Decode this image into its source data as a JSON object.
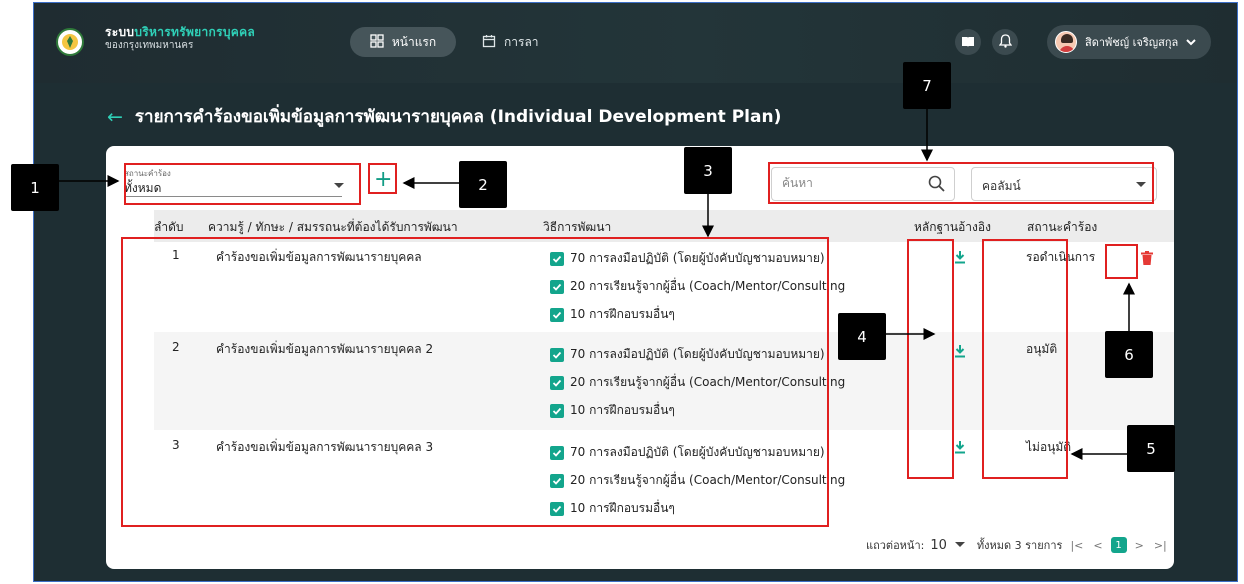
{
  "header": {
    "brand_line1_prefix": "ระบบ",
    "brand_line1_highlight": "บริหารทรัพยากรบุคคล",
    "brand_line2": "ของกรุงเทพมหานคร",
    "nav_home": "หน้าแรก",
    "nav_leave": "การลา",
    "user_name": "สิดาพัชญ์ เจริญสกุล",
    "icons": [
      "book-icon",
      "bell-icon",
      "chevron-down-icon"
    ]
  },
  "page": {
    "title": "รายการคำร้องขอเพิ่มข้อมูลการพัฒนารายบุคคล (Individual Development Plan)"
  },
  "filters": {
    "status_label": "สถานะคำร้อง",
    "status_value": "ทั้งหมด",
    "search_placeholder": "ค้นหา",
    "column_select": "คอลัมน์"
  },
  "table": {
    "headers": {
      "no": "ลำดับ",
      "topic": "ความรู้ / ทักษะ / สมรรถนะที่ต้องได้รับการพัฒนา",
      "method": "วิธีการพัฒนา",
      "evidence": "หลักฐานอ้างอิง",
      "status": "สถานะคำร้อง"
    },
    "rows": [
      {
        "no": "1",
        "topic": "คำร้องขอเพิ่มข้อมูลการพัฒนารายบุคคล",
        "methods": [
          "70 การลงมือปฏิบัติ (โดยผู้บังคับบัญชามอบหมาย)",
          "20 การเรียนรู้จากผู้อื่น (Coach/Mentor/Consulting",
          "10 การฝึกอบรมอื่นๆ"
        ],
        "status": "รอดำเนินการ"
      },
      {
        "no": "2",
        "topic": "คำร้องขอเพิ่มข้อมูลการพัฒนารายบุคคล 2",
        "methods": [
          "70 การลงมือปฏิบัติ (โดยผู้บังคับบัญชามอบหมาย)",
          "20 การเรียนรู้จากผู้อื่น (Coach/Mentor/Consulting",
          "10 การฝึกอบรมอื่นๆ"
        ],
        "status": "อนุมัติ"
      },
      {
        "no": "3",
        "topic": "คำร้องขอเพิ่มข้อมูลการพัฒนารายบุคคล 3",
        "methods": [
          "70 การลงมือปฏิบัติ (โดยผู้บังคับบัญชามอบหมาย)",
          "20 การเรียนรู้จากผู้อื่น (Coach/Mentor/Consulting",
          "10 การฝึกอบรมอื่นๆ"
        ],
        "status": "ไม่อนุมัติ"
      }
    ]
  },
  "pagination": {
    "rows_per_page_label": "แถวต่อหน้า:",
    "rows_per_page": "10",
    "summary": "ทั้งหมด 3 รายการ",
    "first": "|<",
    "prev": "<",
    "current": "1",
    "next": ">",
    "last": ">|"
  },
  "annotations": [
    "1",
    "2",
    "3",
    "4",
    "5",
    "6",
    "7"
  ],
  "colors": {
    "accent": "#13a58c",
    "annotation_red": "#e02020",
    "delete_red": "#e53935"
  }
}
